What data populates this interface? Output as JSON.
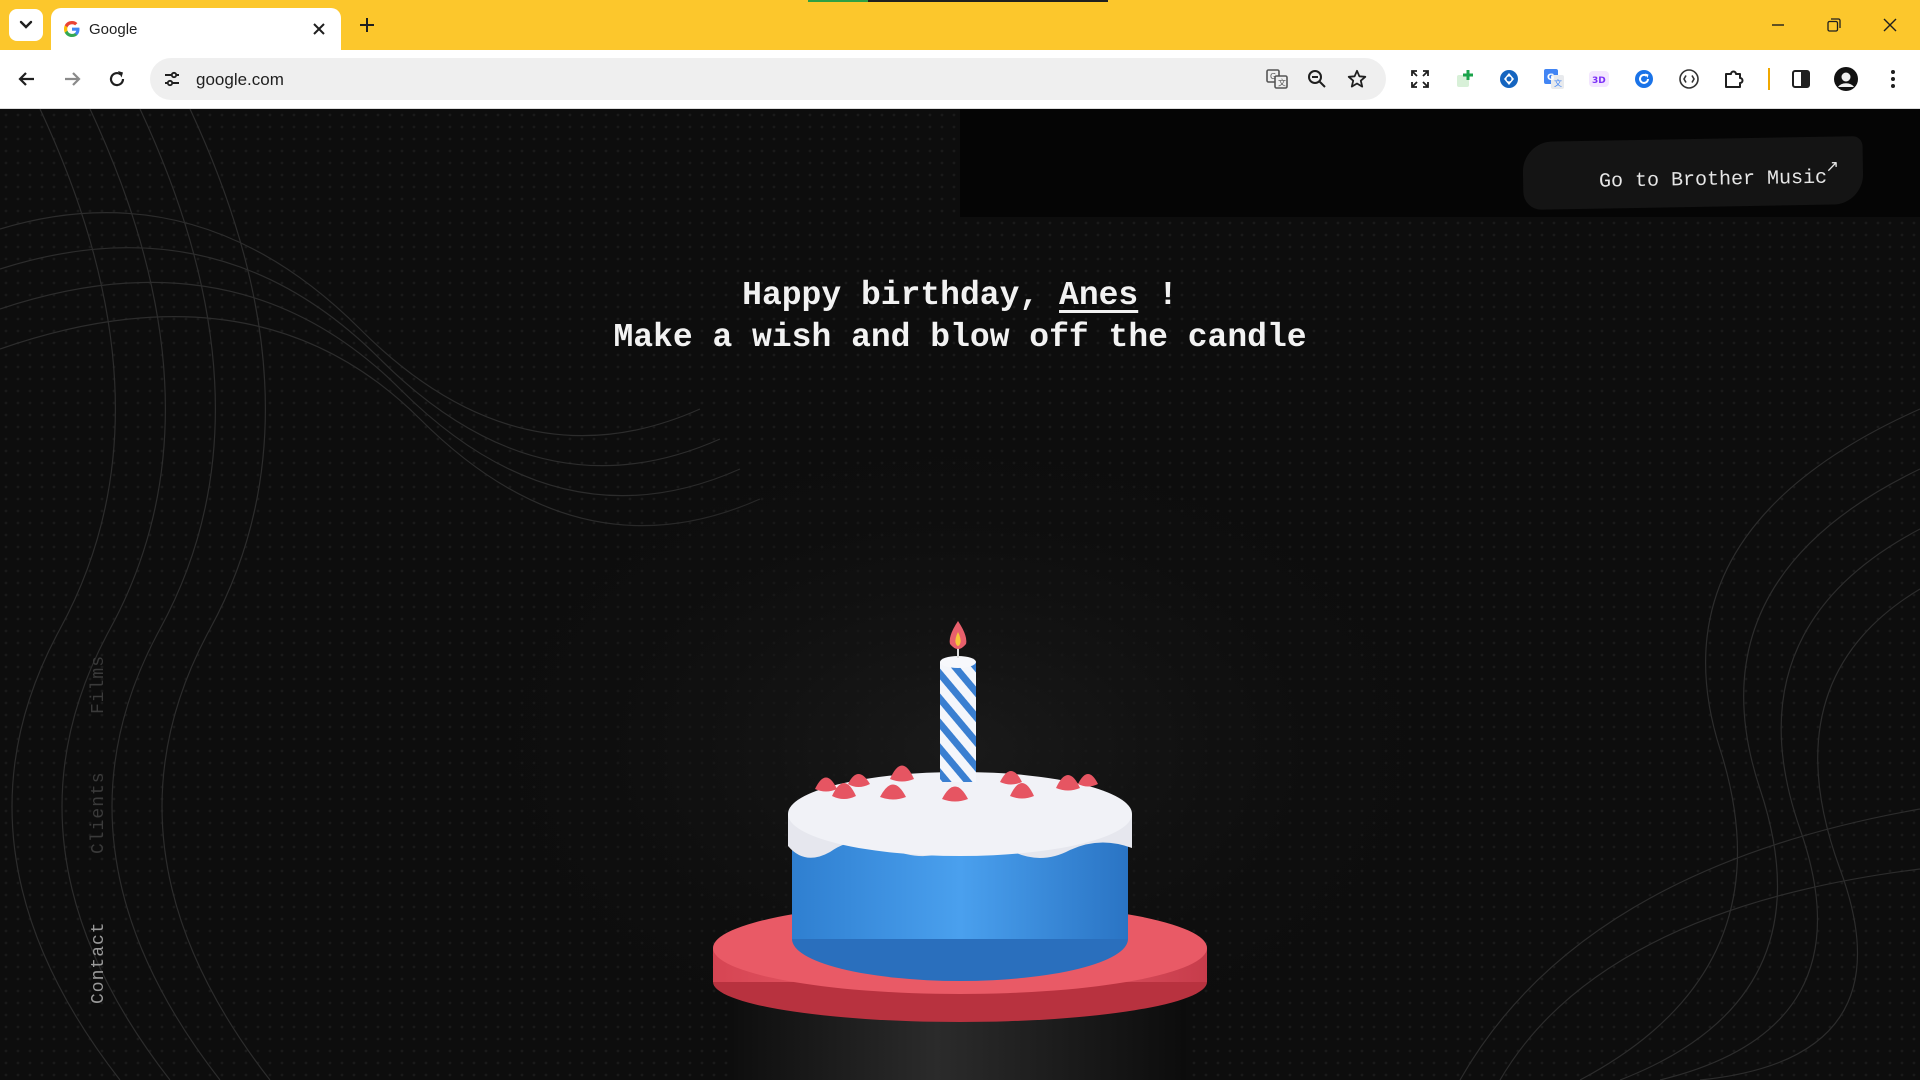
{
  "browser": {
    "tab_title": "Google",
    "url": "google.com"
  },
  "page": {
    "external_link": "Go to Brother Music",
    "greeting_prefix": "Happy birthday,",
    "greeting_name": "Anes",
    "greeting_suffix": "!",
    "subtitle": "Make a wish and blow off the candle",
    "nav": {
      "films": "Films",
      "clients": "Clients",
      "contact": "Contact"
    }
  },
  "colors": {
    "tabbar": "#fcc72c",
    "page_bg": "#0d0d0d",
    "cake_plate": "#e2525f",
    "cake_blue": "#3a8ed8",
    "icing": "#e9e9ee"
  }
}
